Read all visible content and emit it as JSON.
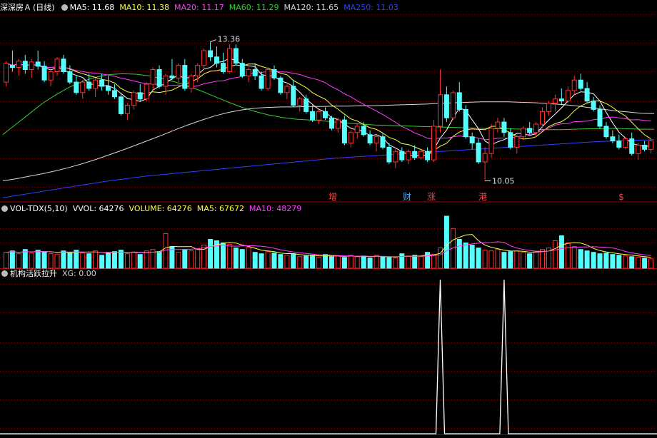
{
  "panels": {
    "price": {
      "stock_name": "深深房Ａ",
      "period": "(日线)",
      "legend": [
        {
          "label": "MA5: 11.68",
          "color": "#ffffff"
        },
        {
          "label": "MA10: 11.38",
          "color": "#ffff40"
        },
        {
          "label": "MA20: 11.17",
          "color": "#ff3cff"
        },
        {
          "label": "MA60: 11.29",
          "color": "#30d030"
        },
        {
          "label": "MA120: 11.65",
          "color": "#d8d8d8"
        },
        {
          "label": "MA250: 11.03",
          "color": "#3040ff"
        }
      ],
      "annotations": [
        {
          "text": "13.36",
          "kind": "high"
        },
        {
          "text": "10.05",
          "kind": "low"
        }
      ],
      "markers": [
        {
          "text": "增",
          "color": "#ff4040"
        },
        {
          "text": "财",
          "color": "#4aa8ff"
        },
        {
          "text": "涨",
          "color": "#ff4040"
        },
        {
          "text": "港",
          "color": "#ff4040"
        },
        {
          "text": "$",
          "color": "#ff4040"
        }
      ]
    },
    "volume": {
      "name": "VOL-TDX(5,10)",
      "legend": [
        {
          "label": "VVOL: 64276",
          "color": "#ffffff"
        },
        {
          "label": "VOLUME: 64276",
          "color": "#ffff40"
        },
        {
          "label": "MA5: 67672",
          "color": "#ffff40"
        },
        {
          "label": "MA10: 48279",
          "color": "#ff3cff"
        }
      ]
    },
    "indicator": {
      "name": "机构活跃拉升",
      "legend": [
        {
          "label": "XG: 0.00",
          "color": "#cccccc"
        }
      ]
    }
  },
  "colors": {
    "up": "#ff3030",
    "down": "#54ffff",
    "grid": "#7a0000",
    "frame": "#aa0000"
  },
  "chart_data": [
    {
      "type": "candlestick",
      "title": "深深房Ａ (日线)",
      "ylim": [
        9.6,
        14.05
      ],
      "candles": [
        [
          12.4,
          12.9,
          12.3,
          12.85
        ],
        [
          12.8,
          13.15,
          12.65,
          12.75
        ],
        [
          12.75,
          12.95,
          12.55,
          12.9
        ],
        [
          12.9,
          13.05,
          12.6,
          12.7
        ],
        [
          12.7,
          12.95,
          12.5,
          12.88
        ],
        [
          12.88,
          13.15,
          12.7,
          12.78
        ],
        [
          12.78,
          12.9,
          12.4,
          12.45
        ],
        [
          12.45,
          12.7,
          12.3,
          12.65
        ],
        [
          12.65,
          13.0,
          12.55,
          12.95
        ],
        [
          12.95,
          13.05,
          12.6,
          12.65
        ],
        [
          12.65,
          12.8,
          12.35,
          12.4
        ],
        [
          12.4,
          12.55,
          12.1,
          12.15
        ],
        [
          12.15,
          12.45,
          12.0,
          12.4
        ],
        [
          12.4,
          12.6,
          12.2,
          12.25
        ],
        [
          12.25,
          12.5,
          12.05,
          12.45
        ],
        [
          12.45,
          12.6,
          12.2,
          12.3
        ],
        [
          12.3,
          12.55,
          12.1,
          12.2
        ],
        [
          12.2,
          12.35,
          12.0,
          12.05
        ],
        [
          12.05,
          12.15,
          11.6,
          11.65
        ],
        [
          11.65,
          11.9,
          11.5,
          11.85
        ],
        [
          11.85,
          12.2,
          11.75,
          12.15
        ],
        [
          12.15,
          12.35,
          11.95,
          12.0
        ],
        [
          12.0,
          12.4,
          11.95,
          12.35
        ],
        [
          12.35,
          12.75,
          12.2,
          12.7
        ],
        [
          12.7,
          12.8,
          12.25,
          12.3
        ],
        [
          12.3,
          12.6,
          12.1,
          12.55
        ],
        [
          12.55,
          12.95,
          12.45,
          12.5
        ],
        [
          12.5,
          12.85,
          12.4,
          12.8
        ],
        [
          12.8,
          12.95,
          12.2,
          12.25
        ],
        [
          12.25,
          12.6,
          12.15,
          12.55
        ],
        [
          12.55,
          12.85,
          12.4,
          12.8
        ],
        [
          12.8,
          13.2,
          12.7,
          13.15
        ],
        [
          13.15,
          13.36,
          12.9,
          13.0
        ],
        [
          13.0,
          13.25,
          12.75,
          12.85
        ],
        [
          12.85,
          13.1,
          12.6,
          12.65
        ],
        [
          12.65,
          13.3,
          12.6,
          13.2
        ],
        [
          13.2,
          13.3,
          12.8,
          12.85
        ],
        [
          12.85,
          12.95,
          12.5,
          12.55
        ],
        [
          12.55,
          12.75,
          12.4,
          12.7
        ],
        [
          12.7,
          12.85,
          12.45,
          12.55
        ],
        [
          12.55,
          12.65,
          12.2,
          12.25
        ],
        [
          12.25,
          12.75,
          12.2,
          12.7
        ],
        [
          12.7,
          12.8,
          12.45,
          12.5
        ],
        [
          12.5,
          12.55,
          12.1,
          12.15
        ],
        [
          12.15,
          12.35,
          12.0,
          12.3
        ],
        [
          12.3,
          12.45,
          11.8,
          11.85
        ],
        [
          11.85,
          12.05,
          11.7,
          12.0
        ],
        [
          12.0,
          12.1,
          11.65,
          11.7
        ],
        [
          11.7,
          11.85,
          11.45,
          11.5
        ],
        [
          11.5,
          11.75,
          11.4,
          11.7
        ],
        [
          11.7,
          11.8,
          11.5,
          11.55
        ],
        [
          11.55,
          11.6,
          11.25,
          11.3
        ],
        [
          11.3,
          11.55,
          11.2,
          11.5
        ],
        [
          11.5,
          11.6,
          10.9,
          10.95
        ],
        [
          10.95,
          11.25,
          10.85,
          11.2
        ],
        [
          11.2,
          11.4,
          11.05,
          11.35
        ],
        [
          11.35,
          11.45,
          11.1,
          11.15
        ],
        [
          11.15,
          11.25,
          10.9,
          10.95
        ],
        [
          10.95,
          11.15,
          10.75,
          11.1
        ],
        [
          11.1,
          11.2,
          10.8,
          10.85
        ],
        [
          10.85,
          10.95,
          10.45,
          10.5
        ],
        [
          10.5,
          10.8,
          10.35,
          10.75
        ],
        [
          10.75,
          10.85,
          10.5,
          10.55
        ],
        [
          10.55,
          10.8,
          10.45,
          10.75
        ],
        [
          10.75,
          10.9,
          10.55,
          10.6
        ],
        [
          10.6,
          10.8,
          10.55,
          10.75
        ],
        [
          10.75,
          10.85,
          10.5,
          10.55
        ],
        [
          10.55,
          11.5,
          10.5,
          11.35
        ],
        [
          11.35,
          12.7,
          11.2,
          12.1
        ],
        [
          12.1,
          12.3,
          11.45,
          11.55
        ],
        [
          11.55,
          12.2,
          11.5,
          12.15
        ],
        [
          12.15,
          12.4,
          11.7,
          11.75
        ],
        [
          11.75,
          11.85,
          11.05,
          11.1
        ],
        [
          11.1,
          11.2,
          10.8,
          10.95
        ],
        [
          10.95,
          11.05,
          10.45,
          10.5
        ],
        [
          10.5,
          10.85,
          10.05,
          10.7
        ],
        [
          10.7,
          11.4,
          10.6,
          11.3
        ],
        [
          11.3,
          11.55,
          11.2,
          11.45
        ],
        [
          11.45,
          11.55,
          11.1,
          11.2
        ],
        [
          11.2,
          11.3,
          10.8,
          10.85
        ],
        [
          10.85,
          11.15,
          10.7,
          11.1
        ],
        [
          11.1,
          11.35,
          11.05,
          11.3
        ],
        [
          11.3,
          11.45,
          11.15,
          11.2
        ],
        [
          11.2,
          11.45,
          11.1,
          11.4
        ],
        [
          11.4,
          11.8,
          11.3,
          11.7
        ],
        [
          11.7,
          11.95,
          11.6,
          11.9
        ],
        [
          11.9,
          12.1,
          11.7,
          12.0
        ],
        [
          12.0,
          12.25,
          11.85,
          11.95
        ],
        [
          11.95,
          12.3,
          11.9,
          12.2
        ],
        [
          12.2,
          12.55,
          12.1,
          12.45
        ],
        [
          12.45,
          12.6,
          12.2,
          12.25
        ],
        [
          12.25,
          12.4,
          11.9,
          11.95
        ],
        [
          11.95,
          12.05,
          11.7,
          11.75
        ],
        [
          11.75,
          11.85,
          11.3,
          11.35
        ],
        [
          11.35,
          11.45,
          11.05,
          11.1
        ],
        [
          11.1,
          11.25,
          10.95,
          11.0
        ],
        [
          11.0,
          11.15,
          10.8,
          10.85
        ],
        [
          10.85,
          11.1,
          10.8,
          11.05
        ],
        [
          11.05,
          11.2,
          10.65,
          10.7
        ],
        [
          10.7,
          10.95,
          10.55,
          10.9
        ],
        [
          10.9,
          11.0,
          10.75,
          10.8
        ],
        [
          10.8,
          11.05,
          10.7,
          11.0
        ]
      ],
      "moving_averages": [
        {
          "name": "MA5",
          "period": 5,
          "color": "#ffffff"
        },
        {
          "name": "MA10",
          "period": 10,
          "color": "#ffff40"
        },
        {
          "name": "MA20",
          "period": 20,
          "color": "#ff3cff"
        }
      ],
      "smooth_series": [
        {
          "name": "MA60",
          "color": "#30d030",
          "values": [
            11.15,
            11.4,
            11.65,
            11.9,
            12.1,
            12.28,
            12.42,
            12.52,
            12.58,
            12.6,
            12.59,
            12.55,
            12.48,
            12.4,
            12.3,
            12.18,
            12.05,
            11.92,
            11.8,
            11.7,
            11.62,
            11.56,
            11.52,
            11.5,
            11.48,
            11.45,
            11.42,
            11.4,
            11.38,
            11.37,
            11.36,
            11.35,
            11.34,
            11.33,
            11.32,
            11.31,
            11.3,
            11.29,
            11.29,
            11.28,
            11.28,
            11.27,
            11.27,
            11.28,
            11.29,
            11.29,
            11.3,
            11.29,
            11.28,
            11.28
          ]
        },
        {
          "name": "MA120",
          "color": "#d8d8d8",
          "values": [
            10.05,
            10.1,
            10.16,
            10.22,
            10.29,
            10.37,
            10.46,
            10.56,
            10.67,
            10.78,
            10.9,
            11.02,
            11.14,
            11.27,
            11.39,
            11.5,
            11.6,
            11.68,
            11.74,
            11.78,
            11.8,
            11.81,
            11.81,
            11.82,
            11.82,
            11.83,
            11.83,
            11.84,
            11.84,
            11.85,
            11.86,
            11.87,
            11.88,
            11.9,
            11.91,
            11.92,
            11.93,
            11.93,
            11.93,
            11.92,
            11.91,
            11.89,
            11.87,
            11.84,
            11.8,
            11.76,
            11.72,
            11.69,
            11.66,
            11.65
          ]
        },
        {
          "name": "MA250",
          "color": "#3040ff",
          "values": [
            9.65,
            9.7,
            9.75,
            9.8,
            9.85,
            9.9,
            9.95,
            10.0,
            10.05,
            10.09,
            10.13,
            10.17,
            10.2,
            10.23,
            10.26,
            10.29,
            10.32,
            10.35,
            10.38,
            10.41,
            10.44,
            10.47,
            10.5,
            10.53,
            10.56,
            10.59,
            10.61,
            10.63,
            10.65,
            10.67,
            10.69,
            10.71,
            10.73,
            10.75,
            10.77,
            10.79,
            10.81,
            10.83,
            10.85,
            10.87,
            10.89,
            10.91,
            10.93,
            10.95,
            10.97,
            10.99,
            11.0,
            11.01,
            11.02,
            11.03
          ]
        }
      ]
    },
    {
      "type": "bar",
      "title": "VOL-TDX(5,10)",
      "ylim": [
        0,
        75000
      ],
      "values": [
        22000,
        24000,
        20000,
        26000,
        21000,
        25000,
        23000,
        20000,
        19000,
        24000,
        22000,
        25000,
        21000,
        20000,
        24000,
        18000,
        22000,
        23000,
        25000,
        20000,
        22000,
        19000,
        24000,
        26000,
        23000,
        48000,
        30000,
        22000,
        26000,
        24000,
        27000,
        32000,
        40000,
        38000,
        35000,
        33000,
        28000,
        26000,
        29000,
        22000,
        20000,
        23000,
        21000,
        19000,
        18000,
        20000,
        16000,
        17000,
        18000,
        15000,
        19000,
        16000,
        17000,
        15000,
        18000,
        16000,
        17000,
        14000,
        18000,
        16000,
        15000,
        14000,
        20000,
        17000,
        18000,
        16000,
        22000,
        19000,
        28000,
        72000,
        55000,
        40000,
        35000,
        32000,
        28000,
        25000,
        24000,
        26000,
        22000,
        23000,
        24000,
        22000,
        20000,
        23000,
        26000,
        28000,
        38000,
        45000,
        35000,
        30000,
        26000,
        24000,
        22000,
        20000,
        21000,
        19000,
        18000,
        17000,
        16000,
        15000,
        14000,
        13000
      ]
    },
    {
      "type": "line",
      "title": "机构活跃拉升",
      "ylim": [
        0,
        1
      ],
      "series": [
        {
          "name": "XG",
          "spikes_at_bar": [
            68,
            78
          ]
        }
      ]
    }
  ]
}
